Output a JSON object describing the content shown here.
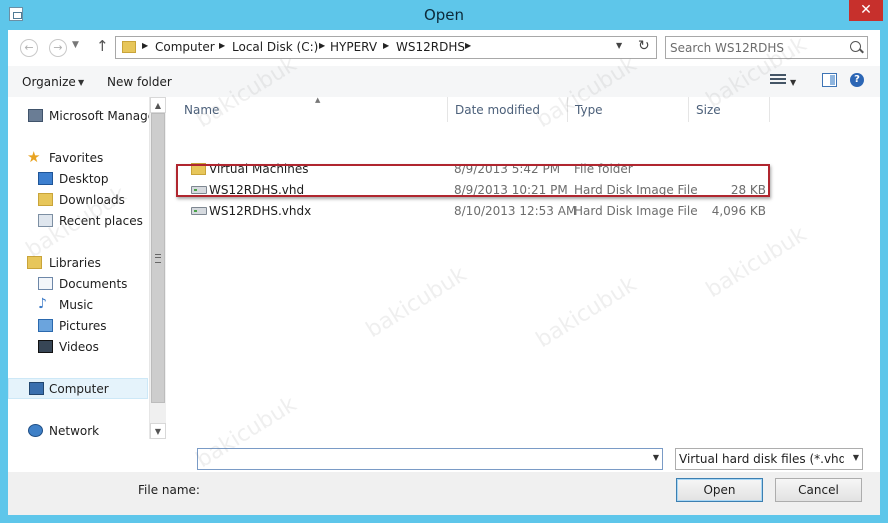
{
  "window": {
    "title": "Open",
    "close_label": "✕"
  },
  "address": {
    "crumbs": [
      "Computer",
      "Local Disk (C:)",
      "HYPERV",
      "WS12RDHS"
    ]
  },
  "search": {
    "placeholder": "Search WS12RDHS"
  },
  "toolbar": {
    "organize_label": "Organize",
    "new_folder_label": "New folder",
    "help_label": "?"
  },
  "sidebar": {
    "items": [
      {
        "label": "Microsoft Manager",
        "icon": "server-manager-icon"
      },
      {
        "label": "Favorites",
        "icon": "star-icon"
      },
      {
        "label": "Desktop",
        "icon": "desktop-icon"
      },
      {
        "label": "Downloads",
        "icon": "downloads-folder-icon"
      },
      {
        "label": "Recent places",
        "icon": "recent-places-icon"
      },
      {
        "label": "Libraries",
        "icon": "libraries-icon"
      },
      {
        "label": "Documents",
        "icon": "documents-icon"
      },
      {
        "label": "Music",
        "icon": "music-icon"
      },
      {
        "label": "Pictures",
        "icon": "pictures-icon"
      },
      {
        "label": "Videos",
        "icon": "videos-icon"
      },
      {
        "label": "Computer",
        "icon": "computer-icon"
      },
      {
        "label": "Network",
        "icon": "network-icon"
      }
    ]
  },
  "files": {
    "columns": [
      "Name",
      "Date modified",
      "Type",
      "Size"
    ],
    "rows": [
      {
        "name": "Virtual Machines",
        "date": "8/9/2013 5:42 PM",
        "type": "File folder",
        "size": "",
        "icon": "folder-icon"
      },
      {
        "name": "WS12RDHS.vhd",
        "date": "8/9/2013 10:21 PM",
        "type": "Hard Disk Image File",
        "size": "28 KB",
        "icon": "disk-image-icon"
      },
      {
        "name": "WS12RDHS.vhdx",
        "date": "8/10/2013 12:53 AM",
        "type": "Hard Disk Image File",
        "size": "4,096 KB",
        "icon": "disk-image-icon"
      }
    ]
  },
  "bottom": {
    "file_name_label": "File name:",
    "file_name_value": "",
    "filter_value": "Virtual hard disk files  (*.vhd;*.",
    "open_label": "Open",
    "cancel_label": "Cancel"
  },
  "watermark": "bakicubuk",
  "colors": {
    "title_bar": "#5ec6ea",
    "close_button": "#c7302c",
    "highlight": "#b0262f"
  }
}
